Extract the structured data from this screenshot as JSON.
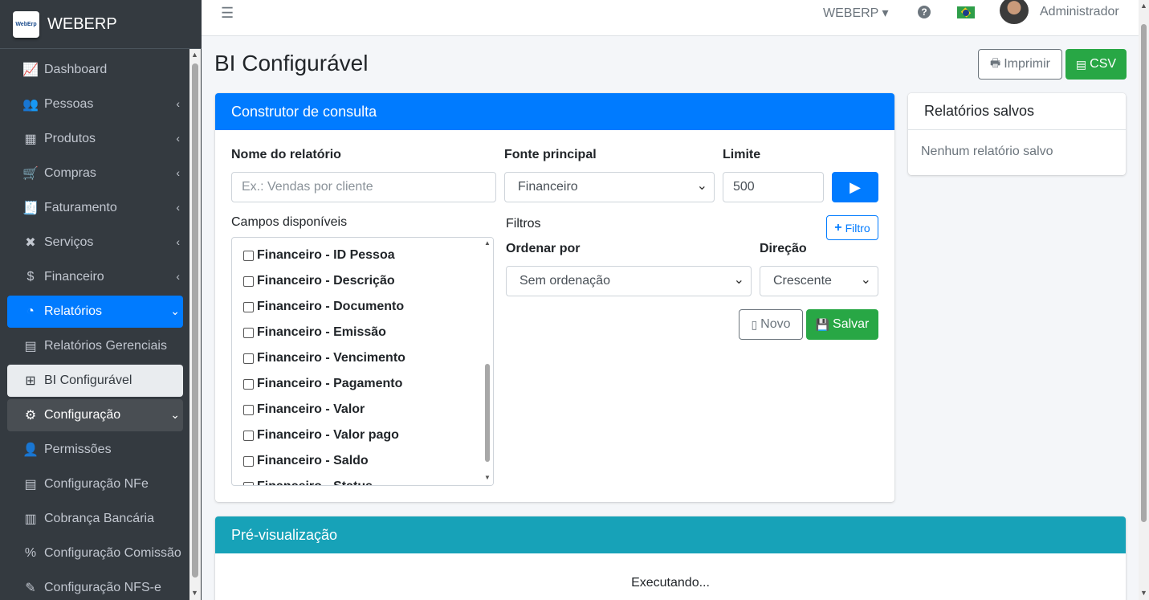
{
  "brand": {
    "name": "WEBERP",
    "logo_text": "WebErp"
  },
  "sidebar": {
    "items": [
      {
        "label": "Dashboard",
        "icon": "chart-line-icon",
        "glyph": "📈"
      },
      {
        "label": "Pessoas",
        "icon": "users-icon",
        "glyph": "👥"
      },
      {
        "label": "Produtos",
        "icon": "boxes-icon",
        "glyph": "▦"
      },
      {
        "label": "Compras",
        "icon": "shopping-cart-icon",
        "glyph": "🛒"
      },
      {
        "label": "Faturamento",
        "icon": "file-invoice-icon",
        "glyph": "🧾"
      },
      {
        "label": "Serviços",
        "icon": "tools-icon",
        "glyph": "✖"
      },
      {
        "label": "Financeiro",
        "icon": "hand-holding-dollar-icon",
        "glyph": "$"
      },
      {
        "label": "Relatórios",
        "icon": "pie-chart-icon",
        "glyph": "◔"
      },
      {
        "label": "Relatórios Gerenciais",
        "icon": "file-alt-icon",
        "glyph": "▤"
      },
      {
        "label": "BI Configurável",
        "icon": "table-icon",
        "glyph": "⊞"
      },
      {
        "label": "Configuração",
        "icon": "cogs-icon",
        "glyph": "⚙"
      },
      {
        "label": "Permissões",
        "icon": "user-shield-icon",
        "glyph": "👤"
      },
      {
        "label": "Configuração NFe",
        "icon": "file-invoice-icon",
        "glyph": "▤"
      },
      {
        "label": "Cobrança Bancária",
        "icon": "barcode-icon",
        "glyph": "▥"
      },
      {
        "label": "Configuração Comissão",
        "icon": "percent-icon",
        "glyph": "%"
      },
      {
        "label": "Configuração NFS-e",
        "icon": "file-signature-icon",
        "glyph": "✎"
      }
    ]
  },
  "topbar": {
    "company": "WEBERP ▾",
    "help": "?",
    "user": "Administrador"
  },
  "page": {
    "title": "BI Configurável",
    "print_label": "Imprimir",
    "csv_label": "CSV"
  },
  "builder": {
    "header": "Construtor de consulta",
    "report_name_label": "Nome do relatório",
    "report_name_placeholder": "Ex.: Vendas por cliente",
    "source_label": "Fonte principal",
    "source_value": "Financeiro",
    "limit_label": "Limite",
    "limit_value": "500",
    "fields_label": "Campos disponíveis",
    "fields": [
      "Financeiro - ID Pessoa",
      "Financeiro - Descrição",
      "Financeiro - Documento",
      "Financeiro - Emissão",
      "Financeiro - Vencimento",
      "Financeiro - Pagamento",
      "Financeiro - Valor",
      "Financeiro - Valor pago",
      "Financeiro - Saldo",
      "Financeiro - Status"
    ],
    "filters_label": "Filtros",
    "add_filter_label": "Filtro",
    "order_label": "Ordenar por",
    "order_value": "Sem ordenação",
    "direction_label": "Direção",
    "direction_value": "Crescente",
    "new_label": "Novo",
    "save_label": "Salvar"
  },
  "saved": {
    "header": "Relatórios salvos",
    "empty": "Nenhum relatório salvo"
  },
  "preview": {
    "header": "Pré-visualização",
    "status": "Executando..."
  },
  "colors": {
    "primary": "#007bff",
    "success": "#28a745",
    "info": "#17a2b8",
    "sidebar": "#343a40"
  }
}
